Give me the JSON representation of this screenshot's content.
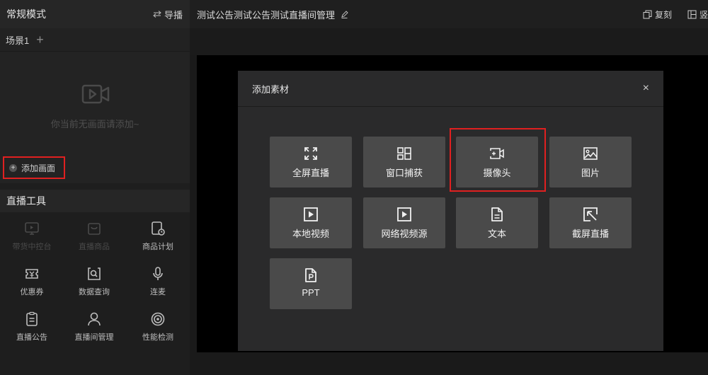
{
  "left_panel": {
    "mode_title": "常规模式",
    "guide_label": "导播",
    "scene_tab": "场景1",
    "scene_add": "+",
    "empty_text": "你当前无画面请添加~",
    "add_canvas_label": "添加画面",
    "tools_title": "直播工具",
    "tools": [
      {
        "label": "带货中控台",
        "icon": "monitor-icon",
        "enabled": false
      },
      {
        "label": "直播商品",
        "icon": "bag-icon",
        "enabled": false
      },
      {
        "label": "商品计划",
        "icon": "plan-icon",
        "enabled": true
      },
      {
        "label": "优惠券",
        "icon": "coupon-icon",
        "enabled": true
      },
      {
        "label": "数据查询",
        "icon": "search-data-icon",
        "enabled": true
      },
      {
        "label": "连麦",
        "icon": "microphone-icon",
        "enabled": true
      },
      {
        "label": "直播公告",
        "icon": "notice-icon",
        "enabled": true
      },
      {
        "label": "直播间管理",
        "icon": "user-icon",
        "enabled": true
      },
      {
        "label": "性能检测",
        "icon": "performance-icon",
        "enabled": true
      }
    ]
  },
  "header": {
    "room_title": "测试公告测试公告测试直播间管理",
    "copy_label": "复刻",
    "vertical_label": "竖"
  },
  "modal": {
    "title": "添加素材",
    "close": "×",
    "items": [
      {
        "label": "全屏直播",
        "icon": "fullscreen-icon"
      },
      {
        "label": "窗口捕获",
        "icon": "window-capture-icon"
      },
      {
        "label": "摄像头",
        "icon": "camera-icon"
      },
      {
        "label": "图片",
        "icon": "image-icon"
      },
      {
        "label": "本地视频",
        "icon": "local-video-icon"
      },
      {
        "label": "网络视频源",
        "icon": "network-video-icon"
      },
      {
        "label": "文本",
        "icon": "text-icon"
      },
      {
        "label": "截屏直播",
        "icon": "screenshot-icon"
      },
      {
        "label": "PPT",
        "icon": "ppt-icon"
      }
    ]
  },
  "colors": {
    "highlight": "#e02020",
    "tile": "#4a4a4a",
    "modal_bg": "#2a2a2b"
  }
}
